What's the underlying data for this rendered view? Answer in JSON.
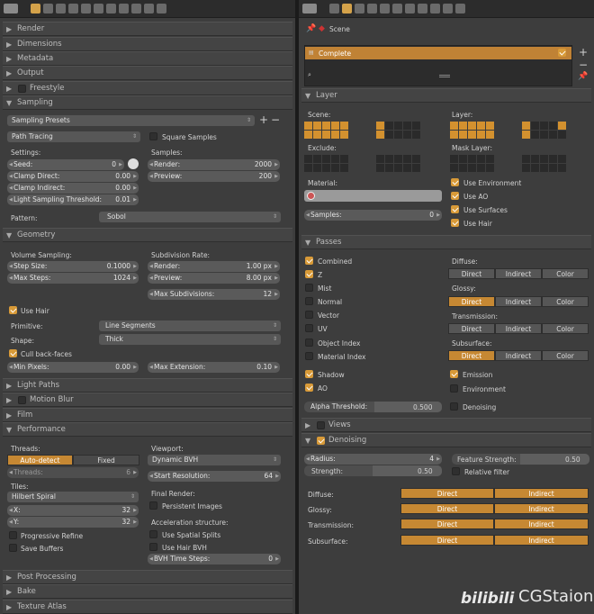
{
  "left": {
    "panels": {
      "render": "Render",
      "dimensions": "Dimensions",
      "metadata": "Metadata",
      "output": "Output",
      "freestyle": "Freestyle",
      "sampling": "Sampling",
      "geometry": "Geometry",
      "light_paths": "Light Paths",
      "motion_blur": "Motion Blur",
      "film": "Film",
      "performance": "Performance",
      "post_processing": "Post Processing",
      "bake": "Bake",
      "texture_atlas": "Texture Atlas"
    },
    "sampling": {
      "presets": "Sampling Presets",
      "integrator": "Path Tracing",
      "square_samples": "Square Samples",
      "settings": "Settings:",
      "samples": "Samples:",
      "seed_label": "Seed:",
      "seed": "0",
      "clamp_direct_label": "Clamp Direct:",
      "clamp_direct": "0.00",
      "clamp_indirect_label": "Clamp Indirect:",
      "clamp_indirect": "0.00",
      "lst_label": "Light Sampling Threshold:",
      "lst": "0.01",
      "render_label": "Render:",
      "render": "2000",
      "preview_label": "Preview:",
      "preview": "200",
      "pattern_label": "Pattern:",
      "pattern": "Sobol"
    },
    "geometry": {
      "vol_sampling": "Volume Sampling:",
      "step_size_label": "Step Size:",
      "step_size": "0.1000",
      "max_steps_label": "Max Steps:",
      "max_steps": "1024",
      "subdiv": "Subdivision Rate:",
      "render_label": "Render:",
      "render": "1.00 px",
      "preview_label": "Preview:",
      "preview": "8.00 px",
      "max_subdiv_label": "Max Subdivisions:",
      "max_subdiv": "12",
      "use_hair": "Use Hair",
      "primitive_label": "Primitive:",
      "primitive": "Line Segments",
      "shape_label": "Shape:",
      "shape": "Thick",
      "cull": "Cull back-faces",
      "min_pixels_label": "Min Pixels:",
      "min_pixels": "0.00",
      "max_ext_label": "Max Extension:",
      "max_ext": "0.10"
    },
    "performance": {
      "threads": "Threads:",
      "auto": "Auto-detect",
      "fixed": "Fixed",
      "threads_label": "Threads:",
      "threads_val": "6",
      "tiles": "Tiles:",
      "tile_order": "Hilbert Spiral",
      "x_label": "X:",
      "x": "32",
      "y_label": "Y:",
      "y": "32",
      "progressive": "Progressive Refine",
      "save_buffers": "Save Buffers",
      "viewport": "Viewport:",
      "bvh": "Dynamic BVH",
      "start_res_label": "Start Resolution:",
      "start_res": "64",
      "final_render": "Final Render:",
      "persistent": "Persistent Images",
      "accel": "Acceleration structure:",
      "spatial": "Use Spatial Splits",
      "hair_bvh": "Use Hair BVH",
      "bvh_steps_label": "BVH Time Steps:",
      "bvh_steps": "0"
    }
  },
  "right": {
    "scene": "Scene",
    "layer_name": "Complete",
    "layer_panel": "Layer",
    "scene_label": "Scene:",
    "layer_label": "Layer:",
    "exclude_label": "Exclude:",
    "mask_label": "Mask Layer:",
    "material_label": "Material:",
    "samples_label": "Samples:",
    "samples": "0",
    "use_env": "Use Environment",
    "use_ao": "Use AO",
    "use_surfaces": "Use Surfaces",
    "use_hair": "Use Hair",
    "passes_panel": "Passes",
    "combined": "Combined",
    "z": "Z",
    "mist": "Mist",
    "normal": "Normal",
    "vector": "Vector",
    "uv": "UV",
    "object_index": "Object Index",
    "material_index": "Material Index",
    "shadow": "Shadow",
    "ao": "AO",
    "diffuse": "Diffuse:",
    "glossy": "Glossy:",
    "transmission": "Transmission:",
    "subsurface": "Subsurface:",
    "direct": "Direct",
    "indirect": "Indirect",
    "color": "Color",
    "emission": "Emission",
    "environment": "Environment",
    "denoising_pass": "Denoising",
    "alpha_label": "Alpha Threshold:",
    "alpha": "0.500",
    "views_panel": "Views",
    "denoising_panel": "Denoising",
    "radius_label": "Radius:",
    "radius": "4",
    "feature_label": "Feature Strength:",
    "feature": "0.50",
    "strength_label": "Strength:",
    "strength": "0.50",
    "relative": "Relative filter",
    "d_diffuse": "Diffuse:",
    "d_glossy": "Glossy:",
    "d_transmission": "Transmission:",
    "d_subsurface": "Subsurface:",
    "watermark": "CGStaion",
    "watermark_logo": "bilibili"
  },
  "colors": {
    "accent": "#d3912f",
    "panel": "#3d3d3d"
  }
}
